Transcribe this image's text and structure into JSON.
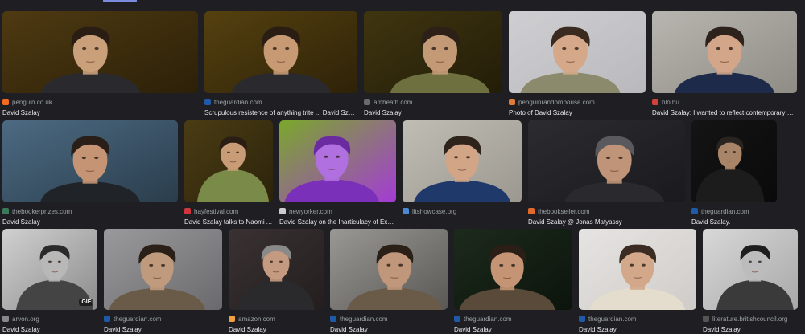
{
  "rows": [
    {
      "images": [
        {
          "source": "penguin.co.uk",
          "title": "David Szalay",
          "bg": "#4e3a12",
          "bg2": "#2c2008",
          "skin": "#c9a07a",
          "hair": "#2a1e14",
          "shirt": "#2a2a2e",
          "fav": "#f26b21",
          "fav_icon": "penguin-favicon"
        },
        {
          "source": "theguardian.com",
          "title": "Scrupulous resistence of anything trite ... David Szalay",
          "bg": "#55410f",
          "bg2": "#2e2208",
          "skin": "#c89a74",
          "hair": "#2a1d14",
          "shirt": "#2a2a2e",
          "fav": "#1e5aa8",
          "fav_icon": "guardian-favicon"
        },
        {
          "source": "amheath.com",
          "title": "David Szalay",
          "bg": "#3f3510",
          "bg2": "#231d08",
          "skin": "#c49a76",
          "hair": "#2d2016",
          "shirt": "#6f7040",
          "fav": "#6a6a6a",
          "fav_icon": "amheath-favicon"
        },
        {
          "source": "penguinrandomhouse.com",
          "title": "Photo of David Szalay",
          "bg": "#cfcfd2",
          "bg2": "#b9b9bd",
          "skin": "#d4a888",
          "hair": "#3a2a20",
          "shirt": "#8c8a6c",
          "fav": "#e07a3c",
          "fav_icon": "prh-favicon"
        },
        {
          "source": "hlo.hu",
          "title": "David Szalay: I wanted to reflect contemporary Europe",
          "bg": "#b8b6b0",
          "bg2": "#8f8c85",
          "skin": "#d3a689",
          "hair": "#2d231c",
          "shirt": "#1d2a4a",
          "fav": "#d0423a",
          "fav_icon": "hlo-favicon"
        }
      ]
    },
    {
      "images": [
        {
          "source": "thebookerprizes.com",
          "title": "David Szalay",
          "bg": "#4c6a82",
          "bg2": "#2a3d4c",
          "skin": "#c49474",
          "hair": "#2a1f18",
          "shirt": "#202428",
          "fav": "#3a7a5a",
          "fav_icon": "booker-favicon"
        },
        {
          "source": "hayfestival.com",
          "title": "David Szalay talks to Naomi Ald...",
          "bg": "#4a3c14",
          "bg2": "#2c230a",
          "skin": "#c89c76",
          "hair": "#2a1e14",
          "shirt": "#7a8a48",
          "fav": "#d0343c",
          "fav_icon": "hay-favicon"
        },
        {
          "source": "newyorker.com",
          "title": "David Szalay on the Inarticulacy of Experie...",
          "bg": "#7aa82a",
          "bg2": "#a43bd6",
          "skin": "#b070e0",
          "hair": "#6a2aa0",
          "shirt": "#7a30b8",
          "fav": "#cccccc",
          "fav_icon": "newyorker-favicon"
        },
        {
          "source": "litshowcase.org",
          "title": "",
          "bg": "#c0bdb4",
          "bg2": "#9c9890",
          "skin": "#d1a586",
          "hair": "#2e241c",
          "shirt": "#1f3a6a",
          "fav": "#4a8ad4",
          "fav_icon": "litshowcase-favicon"
        },
        {
          "source": "thebookseller.com",
          "title": "David Szalay @ Jonas Matyassy",
          "bg": "#2c2c30",
          "bg2": "#1a1a1e",
          "skin": "#c09478",
          "hair": "#5a5a5e",
          "shirt": "#2a2a2e",
          "fav": "#e06a2a",
          "fav_icon": "bookseller-favicon"
        },
        {
          "source": "theguardian.com",
          "title": "David Szalay.",
          "bg": "#141414",
          "bg2": "#0a0a0a",
          "skin": "#a88468",
          "hair": "#2a2420",
          "shirt": "#1c1c1c",
          "fav": "#1e5aa8",
          "fav_icon": "guardian-favicon"
        }
      ]
    },
    {
      "images": [
        {
          "source": "arvon.org",
          "title": "David Szalay",
          "bg": "#d0d0d0",
          "bg2": "#8c8c8c",
          "skin": "#b8b8b8",
          "hair": "#2a2a2a",
          "shirt": "#444444",
          "fav": "#888888",
          "fav_icon": "arvon-favicon",
          "badge": "GIF"
        },
        {
          "source": "theguardian.com",
          "title": "David Szalay",
          "bg": "#9a9a9c",
          "bg2": "#6a6a6c",
          "skin": "#c09a7c",
          "hair": "#2a2018",
          "shirt": "#6a5a48",
          "fav": "#1e5aa8",
          "fav_icon": "guardian-favicon"
        },
        {
          "source": "amazon.com",
          "title": "David Szalay",
          "bg": "#3a3232",
          "bg2": "#241e1e",
          "skin": "#c49a80",
          "hair": "#8a8a8a",
          "shirt": "#2a2a2c",
          "fav": "#f0a040",
          "fav_icon": "amazon-favicon"
        },
        {
          "source": "theguardian.com",
          "title": "David Szalay",
          "bg": "#9a9894",
          "bg2": "#5a5854",
          "skin": "#c0977a",
          "hair": "#2a2018",
          "shirt": "#6a5a48",
          "fav": "#1e5aa8",
          "fav_icon": "guardian-favicon"
        },
        {
          "source": "theguardian.com",
          "title": "David Szalay",
          "bg": "#1c2a1c",
          "bg2": "#0c140c",
          "skin": "#c49474",
          "hair": "#2a1e16",
          "shirt": "#5a4a3a",
          "fav": "#1e5aa8",
          "fav_icon": "guardian-favicon"
        },
        {
          "source": "theguardian.com",
          "title": "David Szalay",
          "bg": "#e6e4e2",
          "bg2": "#cfccc8",
          "skin": "#d3a88a",
          "hair": "#3a2c22",
          "shirt": "#e4dccc",
          "fav": "#1e5aa8",
          "fav_icon": "guardian-favicon"
        },
        {
          "source": "literature.britishcouncil.org",
          "title": "David Szalay",
          "bg": "#d8d8d8",
          "bg2": "#a8a8a8",
          "skin": "#bcbcbc",
          "hair": "#1e1e1e",
          "shirt": "#3a3a3a",
          "fav": "#555555",
          "fav_icon": "britishcouncil-favicon"
        }
      ]
    }
  ]
}
